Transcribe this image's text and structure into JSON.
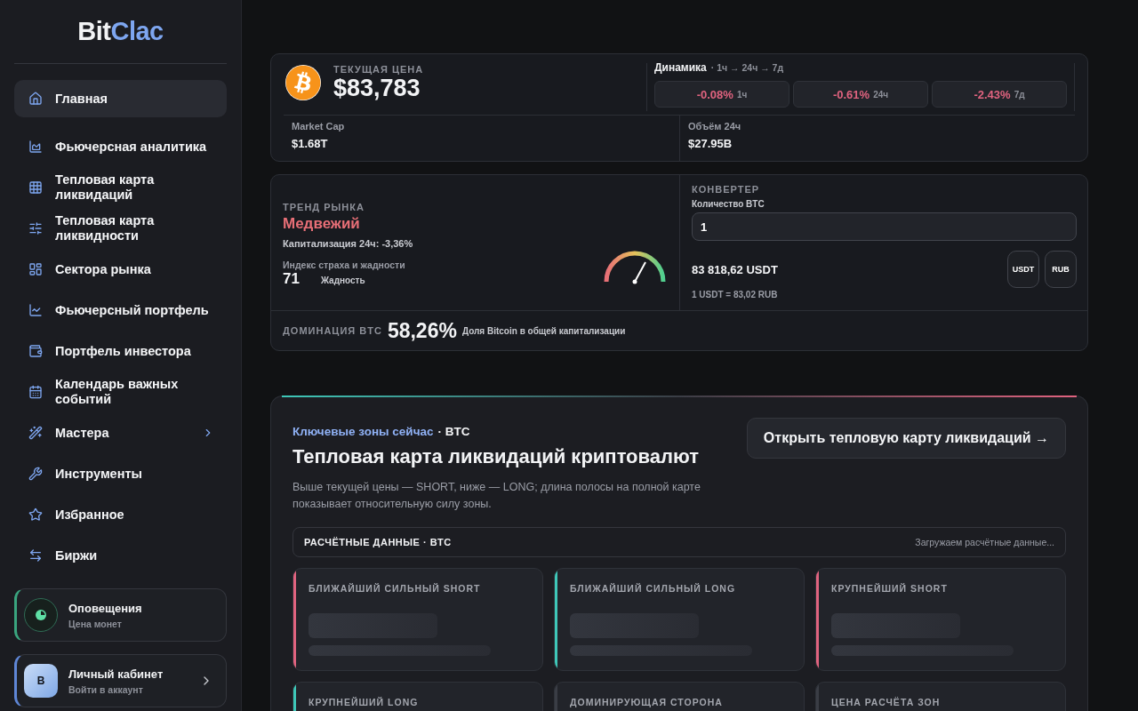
{
  "sidebar": {
    "logo_main": "Bit",
    "logo_accent": "Clac",
    "items": [
      {
        "label": "Главная",
        "selected": true,
        "has_submenu": false
      },
      {
        "label": "Фьючерсная аналитика",
        "selected": false,
        "has_submenu": false
      },
      {
        "label": "Тепловая карта ликвидаций",
        "selected": false,
        "has_submenu": false
      },
      {
        "label": "Тепловая карта ликвидности",
        "selected": false,
        "has_submenu": false
      },
      {
        "label": "Сектора рынка",
        "selected": false,
        "has_submenu": false
      },
      {
        "label": "Фьючерсный портфель",
        "selected": false,
        "has_submenu": false
      },
      {
        "label": "Портфель инвестора",
        "selected": false,
        "has_submenu": false
      },
      {
        "label": "Календарь важных событий",
        "selected": false,
        "has_submenu": false
      },
      {
        "label": "Мастера",
        "selected": false,
        "has_submenu": true
      },
      {
        "label": "Инструменты",
        "selected": false,
        "has_submenu": false
      },
      {
        "label": "Избранное",
        "selected": false,
        "has_submenu": false
      },
      {
        "label": "Биржи",
        "selected": false,
        "has_submenu": false
      }
    ],
    "alerts": {
      "title": "Оповещения",
      "subtitle": "Цена монет"
    },
    "account": {
      "avatar": "B",
      "title": "Личный кабинет",
      "subtitle": "Войти в аккаунт"
    }
  },
  "price_card": {
    "label": "ТЕКУЩАЯ ЦЕНА",
    "price": "$83,783",
    "dynamics": {
      "title": "Динамика",
      "subtitle": "· 1ч → 24ч → 7д",
      "items": [
        {
          "value": "-0.08%",
          "period": "1ч"
        },
        {
          "value": "-0.61%",
          "period": "24ч"
        },
        {
          "value": "-2.43%",
          "period": "7д"
        }
      ]
    },
    "stats": [
      {
        "label": "Market Cap",
        "value": "$1.68T"
      },
      {
        "label": "Объём 24ч",
        "value": "$27.95B"
      }
    ]
  },
  "market_card": {
    "trend_label": "ТРЕНД РЫНКА",
    "trend": "Медвежий",
    "cap_change": "Капитализация 24ч: -3,36%",
    "fear_greed": {
      "label": "Индекс страха и жадности",
      "value": "71",
      "mood": "Жадность"
    },
    "converter": {
      "title": "КОНВЕРТЕР",
      "amount_label": "Количество **BTC**",
      "amount": "1",
      "result": "83 818,62 USDT",
      "buttons": [
        "USDT",
        "RUB"
      ],
      "rate": "1 USDT = 83,02 RUB"
    },
    "dominance": {
      "label": "ДОМИНАЦИЯ BTC",
      "value": "58,26%",
      "caption": "Доля Bitcoin в общей капитализации"
    }
  },
  "zones": {
    "eyebrow": "Ключевые зоны сейчас",
    "eyebrow_coin": "· BTC",
    "title": "Тепловая карта ликвидаций криптовалют",
    "description": "Выше текущей цены — SHORT, ниже — LONG; длина полосы на полной карте показывает относительную силу зоны.",
    "open_button": "Открыть тепловую карту ликвидаций →",
    "data_bar": {
      "title": "РАСЧЁТНЫЕ ДАННЫЕ · BTC",
      "status": "Загружаем расчётные данные..."
    },
    "cards": [
      {
        "title": "БЛИЖАЙШИЙ СИЛЬНЫЙ SHORT",
        "color": "#e0637f",
        "loading": true
      },
      {
        "title": "БЛИЖАЙШИЙ СИЛЬНЫЙ LONG",
        "color": "#3ec7b8",
        "loading": true
      },
      {
        "title": "КРУПНЕЙШИЙ SHORT",
        "color": "#e0637f",
        "loading": true
      },
      {
        "title": "КРУПНЕЙШИЙ LONG",
        "color": "#3ec7b8"
      },
      {
        "title": "ДОМИНИРУЮЩАЯ СТОРОНА",
        "color": "#3a3d45"
      },
      {
        "title": "ЦЕНА РАСЧЁТА ЗОН",
        "color": "#3a3d45"
      }
    ]
  }
}
